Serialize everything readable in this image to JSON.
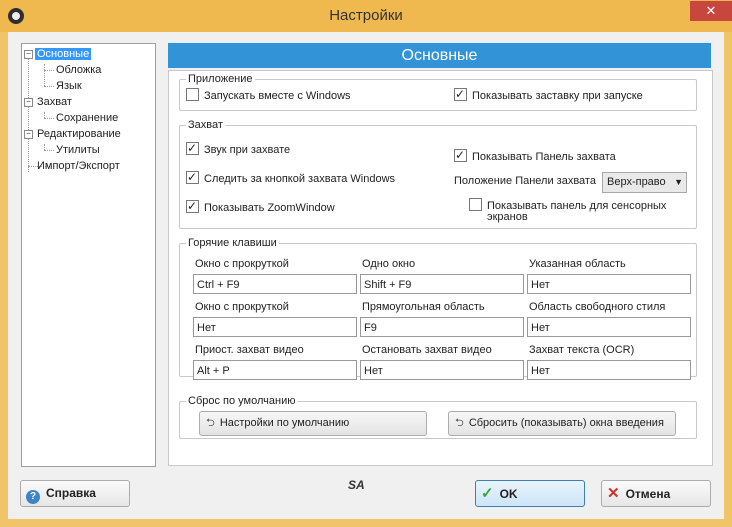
{
  "window": {
    "title": "Настройки"
  },
  "tree": {
    "items": [
      {
        "label": "Основные"
      },
      {
        "label": "Обложка"
      },
      {
        "label": "Язык"
      },
      {
        "label": "Захват"
      },
      {
        "label": "Сохранение"
      },
      {
        "label": "Редактирование"
      },
      {
        "label": "Утилиты"
      },
      {
        "label": "Импорт/Экспорт"
      }
    ]
  },
  "header": {
    "title": "Основные"
  },
  "app_group": {
    "legend": "Приложение",
    "start_with_windows": "Запускать вместе с Windows",
    "show_splash": "Показывать заставку при запуске"
  },
  "capture_group": {
    "legend": "Захват",
    "sound": "Звук при захвате",
    "follow_button": "Следить за кнопкой захвата Windows",
    "show_zoom": "Показывать ZoomWindow",
    "show_panel": "Показывать Панель захвата",
    "panel_position_label": "Положение Панели захвата",
    "panel_position_value": "Верх-право",
    "touch_panel": "Показывать панель для сенсорных",
    "touch_panel_2": "экранов"
  },
  "hotkeys": {
    "legend": "Горячие клавиши",
    "rows": [
      [
        {
          "label": "Окно с прокруткой",
          "value": "Ctrl + F9"
        },
        {
          "label": "Одно окно",
          "value": "Shift + F9"
        },
        {
          "label": "Указанная область",
          "value": "Нет"
        }
      ],
      [
        {
          "label": "Окно с прокруткой",
          "value": "Нет"
        },
        {
          "label": "Прямоугольная область",
          "value": "F9"
        },
        {
          "label": "Область свободного стиля",
          "value": "Нет"
        }
      ],
      [
        {
          "label": "Приост. захват видео",
          "value": "Alt + P"
        },
        {
          "label": "Остановать захват видео",
          "value": "Нет"
        },
        {
          "label": "Захват текста (OCR)",
          "value": "Нет"
        }
      ]
    ]
  },
  "reset": {
    "legend": "Сброс по умолчанию",
    "defaults_button": "Настройки по умолчанию",
    "reset_intro_button": "Сбросить (показывать) окна введения"
  },
  "footer": {
    "help": "Справка",
    "ok": "OK",
    "cancel": "Отмена",
    "signature": "SA"
  },
  "colors": {
    "titlebar": "#efb94f",
    "header_bar": "#3294d6",
    "selection": "#3399ff"
  }
}
